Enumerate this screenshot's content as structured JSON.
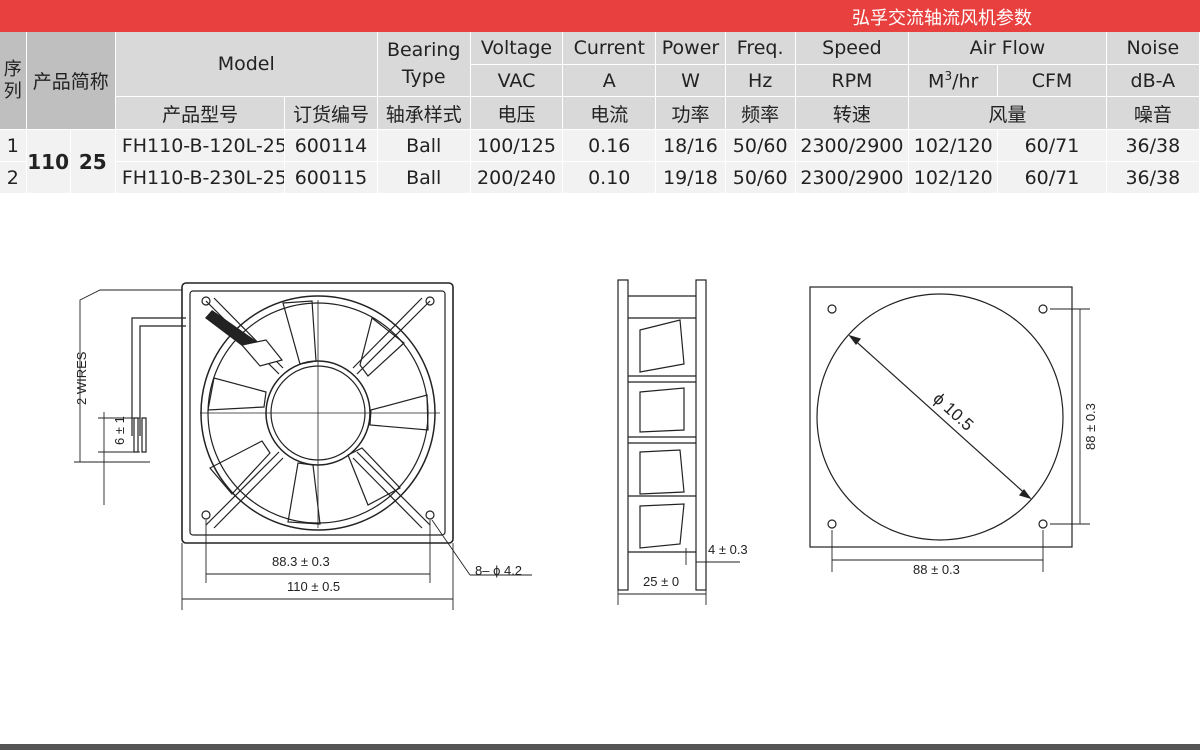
{
  "title": "弘孚交流轴流风机参数",
  "table": {
    "header1": {
      "index": "序列",
      "short_name": "产品简称",
      "model": "Model",
      "bearing": "Bearing Type",
      "voltage": "Voltage",
      "current": "Current",
      "power": "Power",
      "freq": "Freq.",
      "speed": "Speed",
      "airflow": "Air Flow",
      "noise": "Noise"
    },
    "units": {
      "voltage": "VAC",
      "current": "A",
      "power": "W",
      "freq": "Hz",
      "speed": "RPM",
      "airflow_m3": "M",
      "airflow_m3_sup": "3",
      "airflow_m3_tail": "/hr",
      "airflow_cfm": "CFM",
      "noise": "dB-A"
    },
    "header3": {
      "model_no": "产品型号",
      "order_no": "订货编号",
      "bearing": "轴承样式",
      "voltage": "电压",
      "current": "电流",
      "power": "功率",
      "freq": "频率",
      "speed": "转速",
      "airflow": "风量",
      "noise": "噪音"
    },
    "size_a": "110",
    "size_b": "25",
    "rows": [
      {
        "index": "1",
        "model": "FH110-B-120L-25",
        "order": "600114",
        "bearing": "Ball",
        "voltage": "100/125",
        "current": "0.16",
        "power": "18/16",
        "freq": "50/60",
        "speed": "2300/2900",
        "m3hr": "102/120",
        "cfm": "60/71",
        "noise": "36/38"
      },
      {
        "index": "2",
        "model": "FH110-B-230L-25",
        "order": "600115",
        "bearing": "Ball",
        "voltage": "200/240",
        "current": "0.10",
        "power": "19/18",
        "freq": "50/60",
        "speed": "2300/2900",
        "m3hr": "102/120",
        "cfm": "60/71",
        "noise": "36/38"
      }
    ]
  },
  "drawing": {
    "wires_label": "2 WIRES",
    "strip_label": "6 ± 1",
    "hole_pitch": "88.3 ± 0.3",
    "width": "110 ± 0.5",
    "holes": "8– ϕ 4.2",
    "thickness": "25 ± 0",
    "flange": "4 ± 0.3",
    "diameter": "ϕ 10.5",
    "cutout_v": "88 ± 0.3",
    "cutout_h": "88 ± 0.3"
  }
}
